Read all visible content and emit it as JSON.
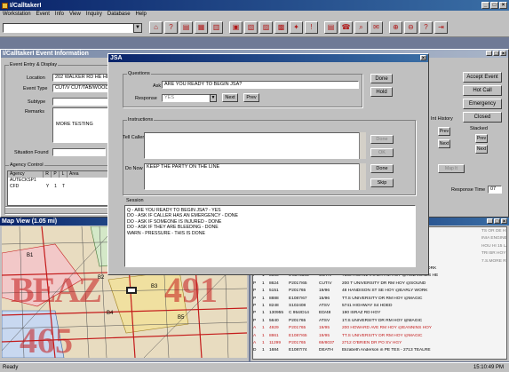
{
  "app": {
    "title": "I/CalltakerI",
    "menu": [
      "Workstation",
      "Event",
      "Info",
      "View",
      "Inquiry",
      "Database",
      "Help"
    ]
  },
  "toolbar_icons": [
    "map-icon",
    "help-icon",
    "dispatch-icon",
    "unit-icon",
    "event-icon",
    "status-icon",
    "premise-icon",
    "incident-icon",
    "display-icon",
    "fire-icon",
    "alarm-icon",
    "report-icon",
    "phone-icon",
    "query-icon",
    "message-icon",
    "zoom-in-icon",
    "zoom-out-icon",
    "help-question-icon",
    "exit-icon"
  ],
  "event_window": {
    "title": "I/CalltakerI Event Information",
    "group_title": "Event Entry & Display",
    "location_label": "Location",
    "location_value": "202 WALKER RD HE HE",
    "event_type_label": "Event Type",
    "event_type_value": "CUT/V  CUT/TAB/WOOD",
    "subtype_label": "Subtype",
    "remarks_label": "Remarks",
    "remarks_value": "MORE TESTING",
    "situation_found_label": "Situation Found",
    "agency_group_title": "Agency Control",
    "agency_columns": [
      "Agency",
      "R",
      "P",
      "L",
      "Area"
    ],
    "agency_rows": [
      [
        "AUTECKSP1",
        "",
        "",
        "",
        ""
      ],
      [
        "CFD",
        "Y",
        "1",
        "T",
        ""
      ]
    ],
    "buttons": {
      "accept_event": "Accept Event",
      "hot_call": "Hot Call",
      "emergency": "Emergency",
      "closed": "Closed"
    },
    "history_label": "Int History",
    "stacked_label": "Stacked",
    "prev_label": "Prev",
    "next_label": "Next",
    "response_time_label": "Response Time",
    "response_time_value": "07",
    "map_it_label": "Map It"
  },
  "dialog": {
    "title": "JSA",
    "questions_group": "Questions",
    "ask_label": "Ask",
    "ask_value": "ARE YOU READY TO BEGIN JSA?",
    "response_label": "Response",
    "response_value": "YES",
    "next_button": "Next",
    "prev_button": "Prev",
    "done_button": "Done",
    "hold_button": "Hold",
    "instructions_group": "Instructions",
    "tell_caller_label": "Tell Caller",
    "do_now_label": "Do Now",
    "do_now_value": "KEEP THE PARTY ON THE LINE",
    "done_right_button": "Done",
    "skip_button": "Skip",
    "ok_button": "OK",
    "session_label": "Session",
    "session_lines": [
      "Q - ARE YOU READY TO BEGIN JSA? - YES",
      "DO - ASK IF CALLER HAS AN EMERGENCY - DONE",
      "DO - ASK IF SOMEONE IS INJURED - DONE",
      "DO - ASK IF THEY ARE BLEEDING - DONE",
      "WARN - PRESSURE - THIS IS DONE"
    ]
  },
  "map_window": {
    "title": "Map View (1.05 mi)",
    "big_labels": [
      "BEAZ",
      "491",
      "465",
      "BEAZ"
    ],
    "road_labels": [
      "B1",
      "B2",
      "B3",
      "B4",
      "B5",
      "B6"
    ]
  },
  "unit_list": {
    "rows": [
      [
        "",
        "",
        "",
        "",
        "",
        "",
        "TS OR DE HSY"
      ],
      [
        "",
        "",
        "",
        "",
        "",
        "",
        "INIA ENGINEER DR HAD @HGB JONES HE"
      ],
      [
        "",
        "",
        "",
        "",
        "",
        "",
        "HOU HI 15 LACK CLUSTERIN INIA ENGINES"
      ],
      [
        "",
        "",
        "",
        "",
        "",
        "",
        "TRI BR HOY @EARLY WORK"
      ],
      [
        "",
        "",
        "",
        "",
        "",
        "",
        "7.S.MORE RP"
      ],
      [
        "P",
        "1",
        "6320",
        "14271",
        "18/96",
        "TT.S UNIVERSITY DR RM HOY @EARLY WORK"
      ],
      [
        "P",
        "1",
        "8690",
        "6 8376505",
        "CUT/V",
        "7300 HIGHWAYS DR RM HOY @HGB JONES HE"
      ],
      [
        "P",
        "1",
        "8624",
        "P2017/65",
        "CUT/V",
        "200 T UNIVERSITY DR RM HOY @SOUND"
      ],
      [
        "P",
        "1",
        "5151",
        "P201765",
        "19/96",
        "48 HANDISON ST SE HOY @EARLY WORK"
      ],
      [
        "P",
        "1",
        "8888",
        "E1087/67",
        "15/96",
        "TT.S UNIVERSITY DR RM HOY @MAGIC"
      ],
      [
        "P",
        "1",
        "8248",
        "S102408",
        "ATSV",
        "5741 HIGHWAY S4 HDED"
      ],
      [
        "P",
        "1",
        "130955",
        "C 954/D14",
        "ED/48",
        "190 ISRAZ RD HOY"
      ],
      [
        "P",
        "1",
        "5640",
        "P201765",
        "ATSV",
        "1T.S UNIVERSITY DR RM HOY @MAGIC"
      ],
      [
        "A",
        "1",
        "4929",
        "P201765",
        "19/95",
        "200 HOWARD AVE RM HOY @EANNINS HOY"
      ],
      [
        "A",
        "1",
        "8861",
        "E1087/65",
        "19/95",
        "TT.S UNIVERSITY DR RM HOY @MAGIC"
      ],
      [
        "A",
        "1",
        "11299",
        "P201765",
        "69/8037",
        "2712 O'BRIEN DR PO SV HGY"
      ],
      [
        "D",
        "1",
        "1684",
        "E1087/74",
        "DEATH",
        "Elizabeth Anderson in PE TES - 2713 TEALRE"
      ]
    ]
  },
  "status_bar": {
    "left": "Ready",
    "time": "15:10:49 PM"
  },
  "colors": {
    "map_red": "#c41a1a",
    "title_blue": "#0a246a",
    "window_gray": "#c0c0c0"
  }
}
